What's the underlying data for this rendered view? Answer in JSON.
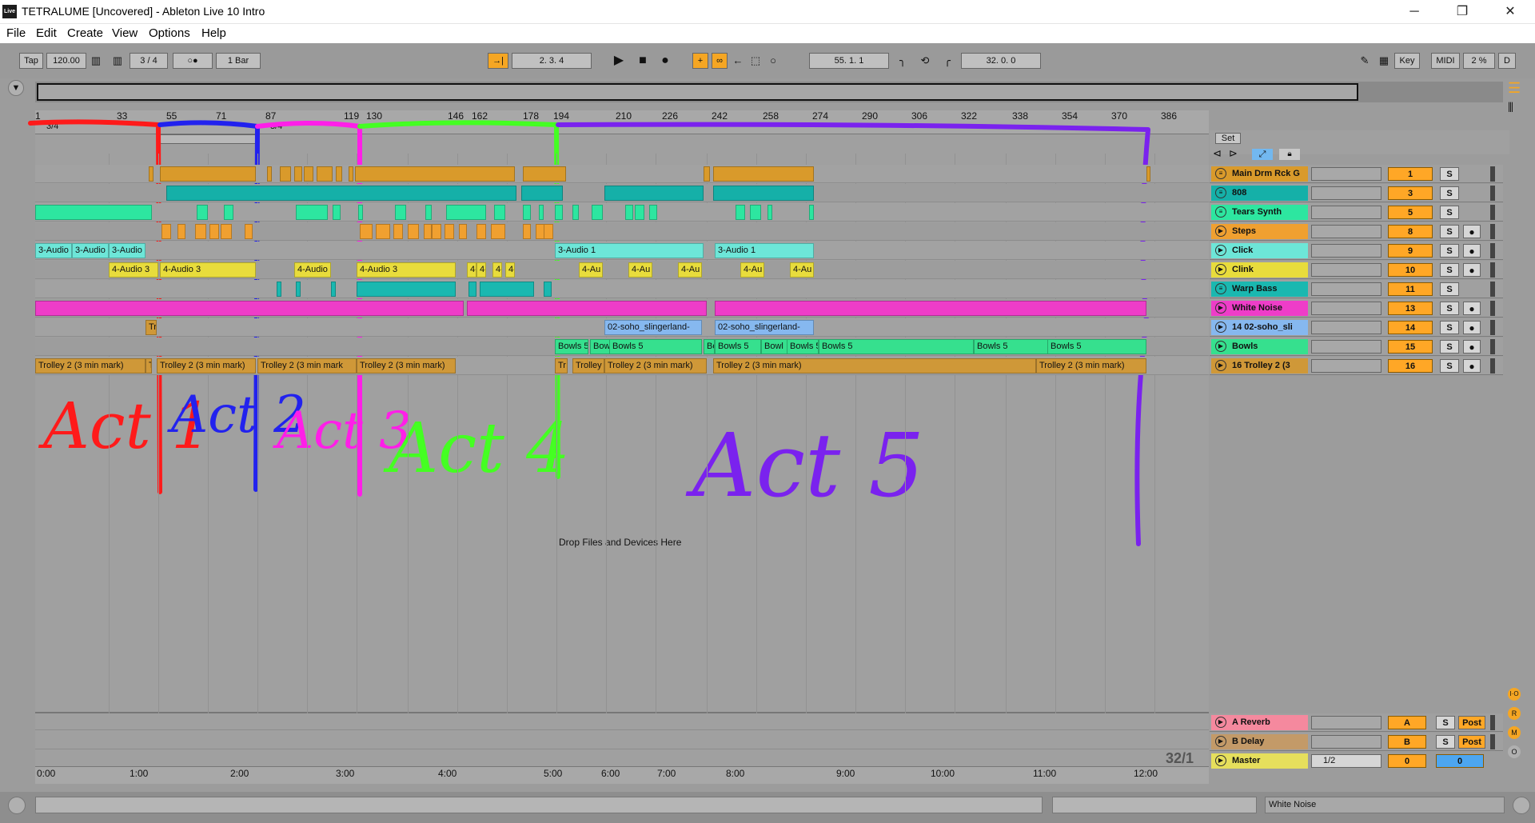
{
  "window": {
    "title": "TETRALUME  [Uncovered] - Ableton Live 10 Intro",
    "logo": "Live",
    "buttons": {
      "minimize": "─",
      "maximize": "❐",
      "close": "✕"
    }
  },
  "menu": [
    "File",
    "Edit",
    "Create",
    "View",
    "Options",
    "Help"
  ],
  "transport": {
    "tap": "Tap",
    "tempo": "120.00",
    "signature_num": "3",
    "signature_den": "4",
    "metronome": "○●",
    "quantize": "1 Bar",
    "arrangement_position": "2.   3.   4",
    "loop_start": "55.   1.   1",
    "loop_length": "32.   0.   0",
    "key": "Key",
    "midi": "MIDI",
    "cpu": "2 %",
    "d": "D"
  },
  "ruler": {
    "signature_left": "3/4",
    "signature_mid": "3/4",
    "bars": [
      "1",
      "33",
      "55",
      "71",
      "87",
      "119",
      "130",
      "146",
      "162",
      "178",
      "194",
      "210",
      "226",
      "242",
      "258",
      "274",
      "290",
      "306",
      "322",
      "338",
      "354",
      "370",
      "386"
    ]
  },
  "time_ruler": [
    "0:00",
    "1:00",
    "2:00",
    "3:00",
    "4:00",
    "5:00",
    "6:00",
    "7:00",
    "8:00",
    "9:00",
    "10:00",
    "11:00",
    "12:00"
  ],
  "set_button": "Set",
  "tracks": [
    {
      "name": "Main Drm Rck G",
      "color": "#d99a2b",
      "num": "1",
      "type": "midi"
    },
    {
      "name": "808",
      "color": "#15b0a8",
      "num": "3",
      "type": "midi"
    },
    {
      "name": "Tears Synth",
      "color": "#2de6a0",
      "num": "5",
      "type": "midi"
    },
    {
      "name": "Steps",
      "color": "#f0a030",
      "num": "8",
      "type": "audio"
    },
    {
      "name": "Click",
      "color": "#6de6d8",
      "num": "9",
      "type": "audio"
    },
    {
      "name": "Clink",
      "color": "#e8dc3c",
      "num": "10",
      "type": "audio"
    },
    {
      "name": "Warp Bass",
      "color": "#1ab8b0",
      "num": "11",
      "type": "midi"
    },
    {
      "name": "White Noise",
      "color": "#ee3dc8",
      "num": "13",
      "type": "audio"
    },
    {
      "name": "14 02-soho_sli",
      "color": "#86b8ef",
      "num": "14",
      "type": "audio"
    },
    {
      "name": "Bowls",
      "color": "#36e08e",
      "num": "15",
      "type": "audio"
    },
    {
      "name": "16 Trolley 2 (3",
      "color": "#cf9838",
      "num": "16",
      "type": "audio"
    }
  ],
  "returns": [
    {
      "name": "A Reverb",
      "color": "#f5899e",
      "num": "A",
      "post": "Post"
    },
    {
      "name": "B Delay",
      "color": "#c39a68",
      "num": "B",
      "post": "Post"
    }
  ],
  "master": {
    "name": "Master",
    "color": "#e6df5c",
    "select": "1/2",
    "num": "0",
    "num2": "0"
  },
  "solo_label": "S",
  "clips": {
    "audio3": "3-Audio",
    "audio3b": "3-Audio",
    "audio3c": "3-Audio",
    "audio1a": "3-Audio 1",
    "audio1b": "3-Audio 1",
    "audio4a": "4-Audio 3",
    "audio4b": "4-Audio 3",
    "audio4c": "4-Audio",
    "audio4d": "4-Audio 3",
    "audio4e": "4-",
    "audio4f": "4-",
    "audio4g": "4-A",
    "audio4h": "4-A",
    "audio4i": "4-Au",
    "audio4j": "4-Au",
    "audio4k": "4-Au",
    "audio4l": "4-Au",
    "audio4m": "4-Au",
    "soho1": "02-soho_slingerland-",
    "soho2": "02-soho_slingerland-",
    "bowls1": "Bowls 5",
    "bowls2": "Bow",
    "bowls3": "Bowls 5",
    "bowls4": "Bo",
    "bowls5": "Bowls 5",
    "bowls6": "Bowl",
    "bowls7": "Bowls 5",
    "bowls8": "Bowls 5",
    "bowls9": "Bowls 5",
    "bowls10": "Bowls 5",
    "trolley1": "Trolley 2 (3 min mark)",
    "trolley2": "Trolley 2 (3 min mark)",
    "trolley3": "Trolley 2 (3 min mark",
    "trolley4": "Trolley 2 (3 min mark)",
    "trolley5": "Trolley 2 (3 min mark)",
    "trolley6": "Trolley",
    "trolley7": "Trolley 2 (3 min mark)",
    "trolley8": "Trolley 2 (3 min mark)",
    "tr": "Tr",
    "t": "T"
  },
  "drop_hint": "Drop Files and Devices Here",
  "page_counter": "32/1",
  "annotations": {
    "act1": "Act 1",
    "act2": "Act 2",
    "act3": "Act 3",
    "act4": "Act 4",
    "act5": "Act 5"
  },
  "statusbar": {
    "selected_track": "White Noise"
  },
  "colors": {
    "act1": "#ff1a1a",
    "act2": "#2222ee",
    "act3": "#ff1ee8",
    "act4": "#44ff22",
    "act5": "#7a22ee"
  }
}
